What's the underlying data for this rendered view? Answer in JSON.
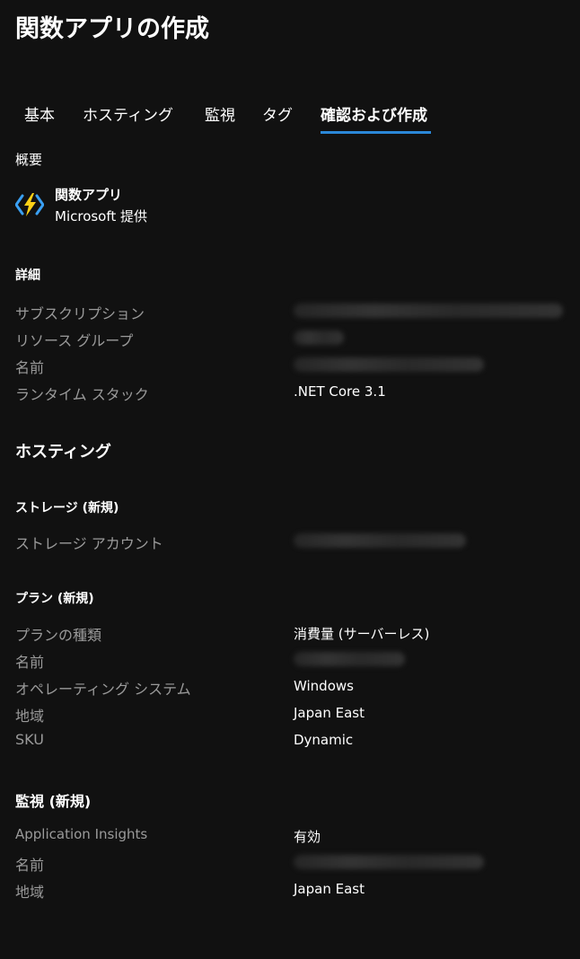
{
  "page_title": "関数アプリの作成",
  "tabs": [
    {
      "label": "基本"
    },
    {
      "label": "ホスティング"
    },
    {
      "label": "監視"
    },
    {
      "label": "タグ"
    },
    {
      "label": "確認および作成"
    }
  ],
  "accent_color": "#2b88d8",
  "overview": {
    "heading": "概要",
    "product_name": "関数アプリ",
    "provider": "Microsoft 提供",
    "icon": "function-app-icon"
  },
  "details": {
    "heading": "詳細",
    "rows": [
      {
        "label": "サブスクリプション",
        "value": null
      },
      {
        "label": "リソース グループ",
        "value": null
      },
      {
        "label": "名前",
        "value": null
      },
      {
        "label": "ランタイム スタック",
        "value": ".NET Core 3.1"
      }
    ]
  },
  "hosting": {
    "heading": "ホスティング",
    "storage": {
      "heading": "ストレージ (新規)",
      "rows": [
        {
          "label": "ストレージ アカウント",
          "value": null
        }
      ]
    },
    "plan": {
      "heading": "プラン (新規)",
      "rows": [
        {
          "label": "プランの種類",
          "value": "消費量 (サーバーレス)"
        },
        {
          "label": "名前",
          "value": null
        },
        {
          "label": "オペレーティング システム",
          "value": "Windows"
        },
        {
          "label": "地域",
          "value": "Japan East"
        },
        {
          "label": "SKU",
          "value": "Dynamic"
        }
      ]
    }
  },
  "monitoring": {
    "heading": "監視 (新規)",
    "rows": [
      {
        "label": "Application Insights",
        "value": "有効"
      },
      {
        "label": "名前",
        "value": null
      },
      {
        "label": "地域",
        "value": "Japan East"
      }
    ]
  }
}
